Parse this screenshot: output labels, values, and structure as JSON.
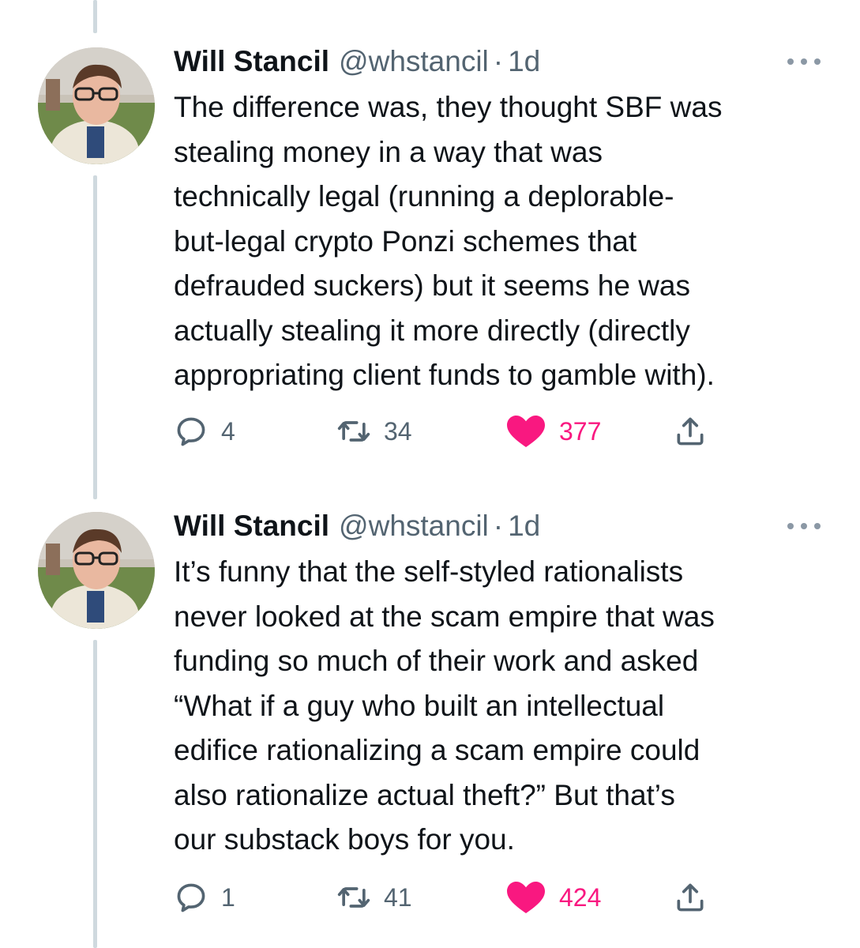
{
  "tweets": [
    {
      "author_name": "Will Stancil",
      "author_handle": "@whstancil",
      "separator": "·",
      "time": "1d",
      "lines": [
        "The difference was, they thought SBF was",
        "stealing money in a way that was",
        "technically legal (running a deplorable-",
        "but-legal crypto Ponzi schemes that",
        "defrauded suckers) but it seems he was",
        "actually stealing it more directly (directly",
        "appropriating client funds to gamble with)."
      ],
      "replies": "4",
      "retweets": "34",
      "likes": "377"
    },
    {
      "author_name": "Will Stancil",
      "author_handle": "@whstancil",
      "separator": "·",
      "time": "1d",
      "lines": [
        "It’s funny that the self-styled rationalists",
        "never looked at the scam empire that was",
        "funding so much of their work and asked",
        "“What if a guy who built an intellectual",
        "edifice rationalizing a scam empire could",
        "also rationalize actual theft?” But that’s",
        "our substack boys for you."
      ],
      "replies": "1",
      "retweets": "41",
      "likes": "424"
    }
  ],
  "icons": {
    "reply": "speech-bubble-icon",
    "retweet": "retweet-arrows-icon",
    "like": "heart-icon",
    "share": "share-upload-icon",
    "more": "three-dots-icon"
  },
  "colors": {
    "text": "#0f1419",
    "secondary": "#536471",
    "like_active": "#f91880",
    "thread_line": "#cfd9de"
  }
}
